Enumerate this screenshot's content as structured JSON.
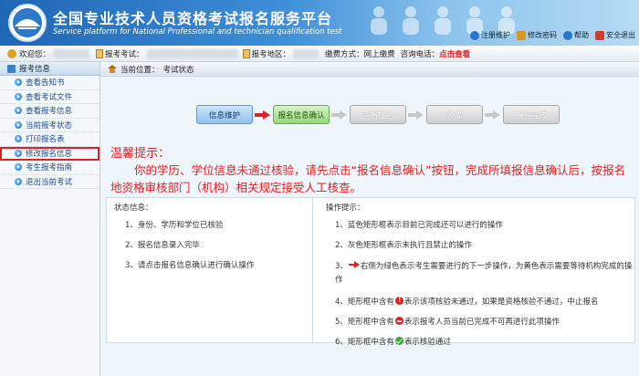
{
  "header": {
    "title_cn": "全国专业技术人员资格考试报名服务平台",
    "title_en": "Service platform for National Professional and technician qualification test",
    "links": [
      {
        "label": "注册维护",
        "color": "#2a74c8"
      },
      {
        "label": "修改密码",
        "color": "#d99a1e"
      },
      {
        "label": "帮助",
        "color": "#2a74c8"
      },
      {
        "label": "安全退出",
        "color": "#d23a2a"
      }
    ]
  },
  "infobar": {
    "welcome": "欢迎您：",
    "exam_label": "报考考试：",
    "region_label": "报考地区：",
    "pay_label": "缴费方式：",
    "pay_value": "网上缴费",
    "phone_label": "咨询电话：",
    "phone_link": "点击查看"
  },
  "sidebar": {
    "head": "报考信息",
    "items": [
      {
        "label": "查看告知书"
      },
      {
        "label": "查看考试文件"
      },
      {
        "label": "查看报考信息"
      },
      {
        "label": "当前报考状态"
      },
      {
        "label": "打印报名表"
      },
      {
        "label": "修改报名信息"
      },
      {
        "label": "考生报考指南"
      },
      {
        "label": "退出当前考试"
      }
    ]
  },
  "main": {
    "crumb_label": "当前位置：",
    "crumb_value": "考试状态",
    "steps": [
      {
        "label": "信息维护"
      },
      {
        "label": "报名信息确认"
      },
      {
        "label": "资格核验"
      },
      {
        "label": "缴 费"
      },
      {
        "label": "报名完成"
      }
    ],
    "tip_title": "温馨提示：",
    "tip_body": "你的学历、学位信息未通过核验，请先点击“报名信息确认”按钮，完成所填报信息确认后，按报名地资格审核部门（机构）相关规定接受人工核查。",
    "status_title": "状态信息：",
    "status_rows": [
      "1、身份、学历和学位已核验",
      "2、报名信息录入完毕",
      "3、请点击报名信息确认进行确认操作"
    ],
    "ops_title": "操作提示：",
    "ops": {
      "r1": "1、蓝色矩形框表示目前已完成还可以进行的操作",
      "r2": "2、灰色矩形框表示未执行且禁止的操作",
      "r3a": "3、",
      "r3b": "右侧为绿色表示考生需要进行的下一步操作，为黄色表示需要等待机构完成的操作",
      "r4a": "4、矩形框中含有",
      "r4b": "表示该项核验未通过，如果是资格核验不通过，中止报名",
      "r5a": "5、矩形框中含有",
      "r5b": "表示报考人员当前已完成不可再进行此项操作",
      "r6a": "6、矩形框中含有",
      "r6b": "表示核验通过"
    }
  }
}
